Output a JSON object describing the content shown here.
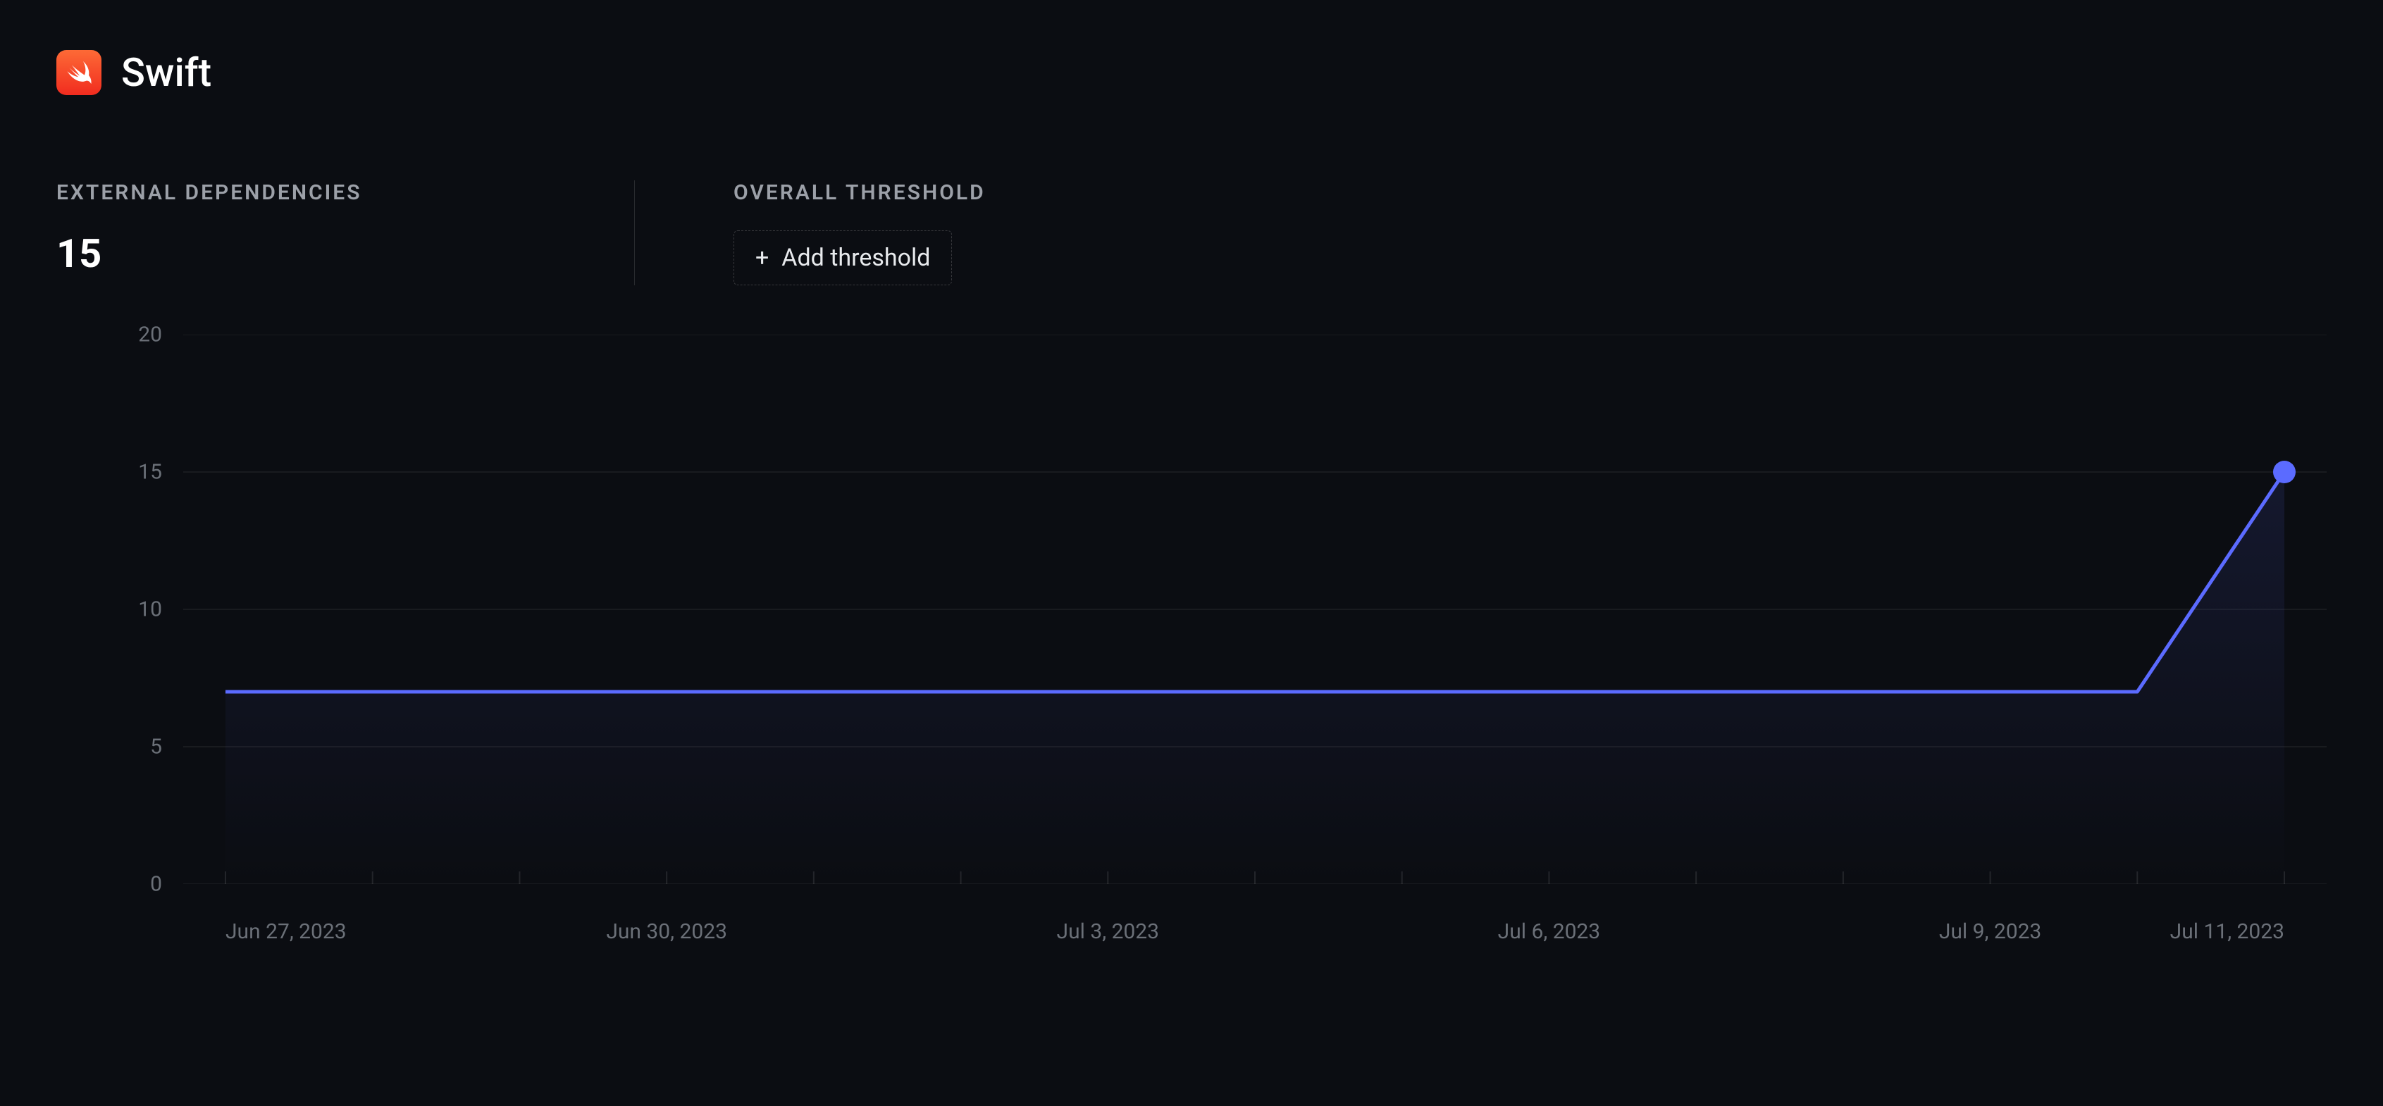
{
  "header": {
    "title": "Swift",
    "logo_name": "swift-logo"
  },
  "metrics": {
    "external_dependencies": {
      "label": "EXTERNAL DEPENDENCIES",
      "value": "15"
    },
    "overall_threshold": {
      "label": "OVERALL THRESHOLD",
      "add_button_label": "Add threshold"
    }
  },
  "chart_data": {
    "type": "line",
    "title": "",
    "xlabel": "",
    "ylabel": "",
    "ylim": [
      0,
      20
    ],
    "y_ticks": [
      0,
      5,
      10,
      15,
      20
    ],
    "x_tick_labels": [
      "Jun 27, 2023",
      "Jun 30, 2023",
      "Jul 3, 2023",
      "Jul 6, 2023",
      "Jul 9, 2023",
      "Jul 11, 2023"
    ],
    "x": [
      "Jun 27, 2023",
      "Jun 28, 2023",
      "Jun 29, 2023",
      "Jun 30, 2023",
      "Jul 1, 2023",
      "Jul 2, 2023",
      "Jul 3, 2023",
      "Jul 4, 2023",
      "Jul 5, 2023",
      "Jul 6, 2023",
      "Jul 7, 2023",
      "Jul 8, 2023",
      "Jul 9, 2023",
      "Jul 10, 2023",
      "Jul 11, 2023"
    ],
    "series": [
      {
        "name": "External dependencies",
        "color": "#5b6bff",
        "values": [
          7,
          7,
          7,
          7,
          7,
          7,
          7,
          7,
          7,
          7,
          7,
          7,
          7,
          7,
          15
        ]
      }
    ],
    "highlight_last_point": true
  }
}
